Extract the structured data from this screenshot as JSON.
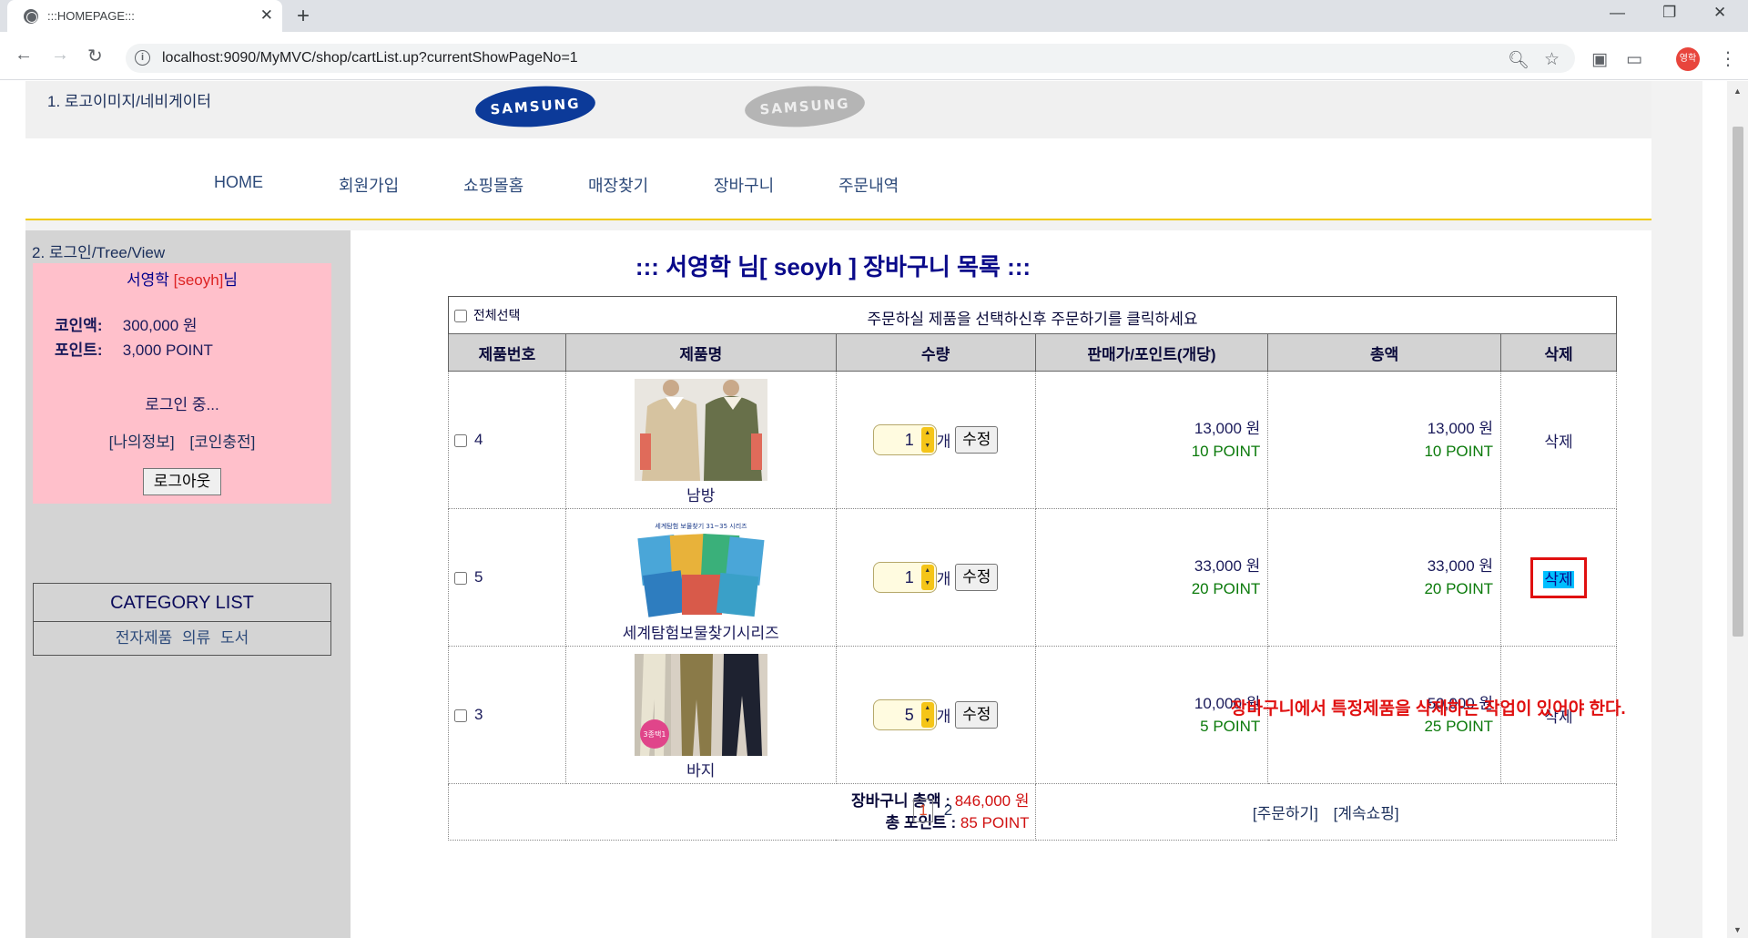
{
  "browser": {
    "tab_title": ":::HOMEPAGE:::",
    "url": "localhost:9090/MyMVC/shop/cartList.up?currentShowPageNo=1",
    "profile_initials": "영학"
  },
  "header": {
    "logo_label": "1. 로고이미지/네비게이터",
    "logo_text_1": "SAMSUNG",
    "logo_text_2": "SAMSUNG"
  },
  "nav": {
    "items": [
      "HOME",
      "회원가입",
      "쇼핑몰홈",
      "매장찾기",
      "장바구니",
      "주문내역"
    ]
  },
  "sidebar": {
    "label": "2. 로그인/Tree/View",
    "user_name": "서영학",
    "user_id": "[seoyh]",
    "user_suffix": "님",
    "coin_label": "코인액:",
    "coin_value": "300,000 원",
    "point_label": "포인트:",
    "point_value": "3,000 POINT",
    "status": "로그인 중...",
    "link_myinfo": "[나의정보]",
    "link_coin": "[코인충전]",
    "logout_label": "로그아웃",
    "category_title": "CATEGORY LIST",
    "categories": [
      "전자제품",
      "의류",
      "도서"
    ]
  },
  "cart": {
    "title": "::: 서영학 님[ seoyh ] 장바구니 목록 :::",
    "select_all": "전체선택",
    "instruction": "주문하실 제품을 선택하신후 주문하기를 클릭하세요",
    "columns": [
      "제품번호",
      "제품명",
      "수량",
      "판매가/포인트(개당)",
      "총액",
      "삭제"
    ],
    "items": [
      {
        "no": "4",
        "name": "남방",
        "qty": "1",
        "unit": "개",
        "edit": "수정",
        "price": "13,000 원",
        "point": "10 POINT",
        "total": "13,000 원",
        "total_point": "10 POINT",
        "delete": "삭제"
      },
      {
        "no": "5",
        "name": "세계탐험보물찾기시리즈",
        "qty": "1",
        "unit": "개",
        "edit": "수정",
        "price": "33,000 원",
        "point": "20 POINT",
        "total": "33,000 원",
        "total_point": "20 POINT",
        "delete": "삭제"
      },
      {
        "no": "3",
        "name": "바지",
        "qty": "5",
        "unit": "개",
        "edit": "수정",
        "price": "10,000 원",
        "point": "5 POINT",
        "total": "50,000 원",
        "total_point": "25 POINT",
        "delete": "삭제"
      }
    ],
    "total_label": "장바구니 총액 :",
    "total_value": "846,000 원",
    "point_total_label": "총 포인트 :",
    "point_total_value": "85 POINT",
    "order_link": "[주문하기]",
    "continue_link": "[계속쇼핑]",
    "annotation": "장바구니에서 특정제품을 삭제하는 작업이 있어야 한다."
  },
  "pager": {
    "current": "1",
    "next": "2"
  },
  "colors": {
    "accent_line": "#f0c900",
    "sidebar_pink": "#ffc0cb",
    "delete_highlight": "#00bfff",
    "annotation_red": "#e01010"
  }
}
